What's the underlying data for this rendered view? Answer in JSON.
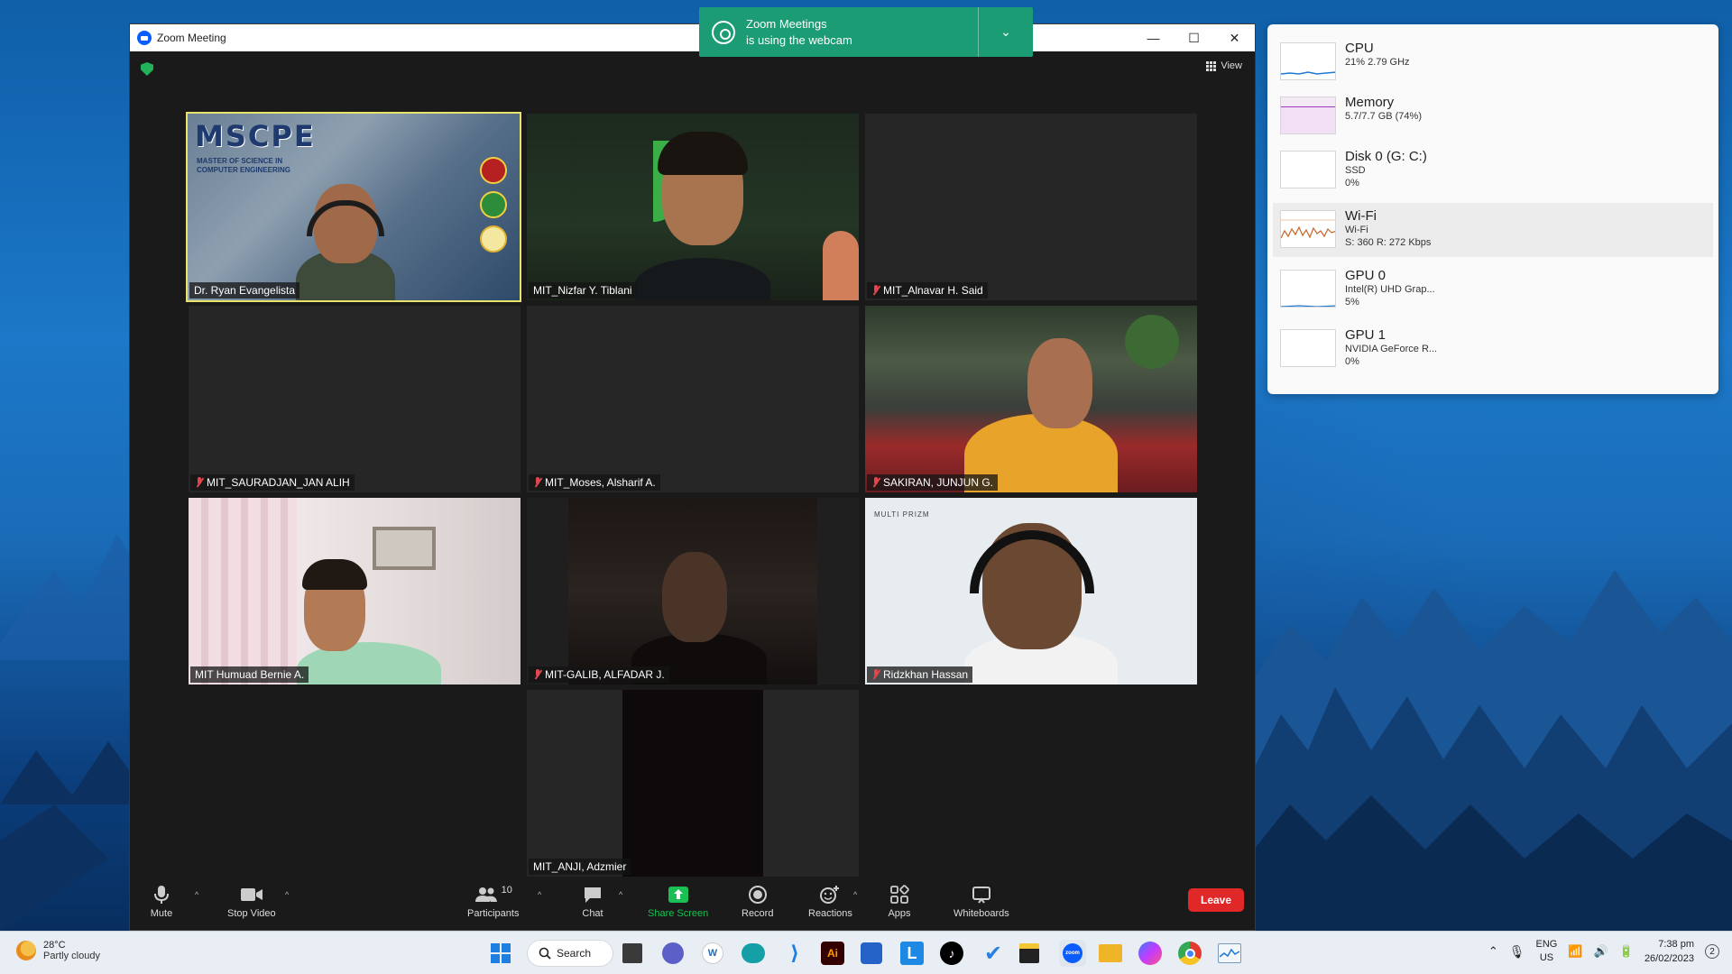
{
  "window": {
    "title": "Zoom Meeting",
    "minimize": "—",
    "maximize": "☐",
    "close": "✕"
  },
  "view_label": "View",
  "notification": {
    "line1": "Zoom Meetings",
    "line2": "is using the webcam"
  },
  "tiles": [
    {
      "name": "Dr. Ryan Evangelista",
      "muted": false,
      "active": true
    },
    {
      "name": "MIT_Nizfar Y. Tiblani",
      "muted": false,
      "active": false
    },
    {
      "name": "MIT_Alnavar H. Said",
      "muted": true,
      "active": false
    },
    {
      "name": "MIT_SAURADJAN_JAN ALIH",
      "muted": true,
      "active": false
    },
    {
      "name": "MIT_Moses, Alsharif A.",
      "muted": true,
      "active": false
    },
    {
      "name": "SAKIRAN, JUNJUN G.",
      "muted": true,
      "active": false
    },
    {
      "name": "MIT Humuad Bernie A.",
      "muted": false,
      "active": false
    },
    {
      "name": "MIT-GALIB, ALFADAR J.",
      "muted": true,
      "active": false
    },
    {
      "name": "Ridzkhan Hassan",
      "muted": true,
      "active": false
    },
    {
      "name": "MIT_ANJI, Adzmier",
      "muted": false,
      "active": false
    }
  ],
  "video_text": {
    "mscpe": "MSCPE",
    "mscpe_sub1": "MASTER OF SCIENCE IN",
    "mscpe_sub2": "COMPUTER ENGINEERING",
    "multiprizm": "MULTI PRIZM"
  },
  "toolbar": {
    "mute": "Mute",
    "stop_video": "Stop Video",
    "participants": "Participants",
    "participants_count": "10",
    "chat": "Chat",
    "share_screen": "Share Screen",
    "record": "Record",
    "reactions": "Reactions",
    "apps": "Apps",
    "whiteboards": "Whiteboards",
    "leave": "Leave",
    "caret": "^"
  },
  "perf": [
    {
      "title": "CPU",
      "sub1": "21% 2.79 GHz",
      "sub2": ""
    },
    {
      "title": "Memory",
      "sub1": "5.7/7.7 GB (74%)",
      "sub2": ""
    },
    {
      "title": "Disk 0 (G: C:)",
      "sub1": "SSD",
      "sub2": "0%"
    },
    {
      "title": "Wi-Fi",
      "sub1": "Wi-Fi",
      "sub2": "S: 360 R: 272 Kbps"
    },
    {
      "title": "GPU 0",
      "sub1": "Intel(R) UHD Grap...",
      "sub2": "5%"
    },
    {
      "title": "GPU 1",
      "sub1": "NVIDIA GeForce R...",
      "sub2": "0%"
    }
  ],
  "taskbar": {
    "weather_temp": "28°C",
    "weather_desc": "Partly cloudy",
    "search": "Search",
    "lang1": "ENG",
    "lang2": "US",
    "time": "7:38 pm",
    "date": "26/02/2023",
    "notif_count": "2"
  },
  "colors": {
    "leave": "#e02828",
    "share": "#1bbf53",
    "active_border": "#e8e36a",
    "notification": "#1c9c74"
  }
}
